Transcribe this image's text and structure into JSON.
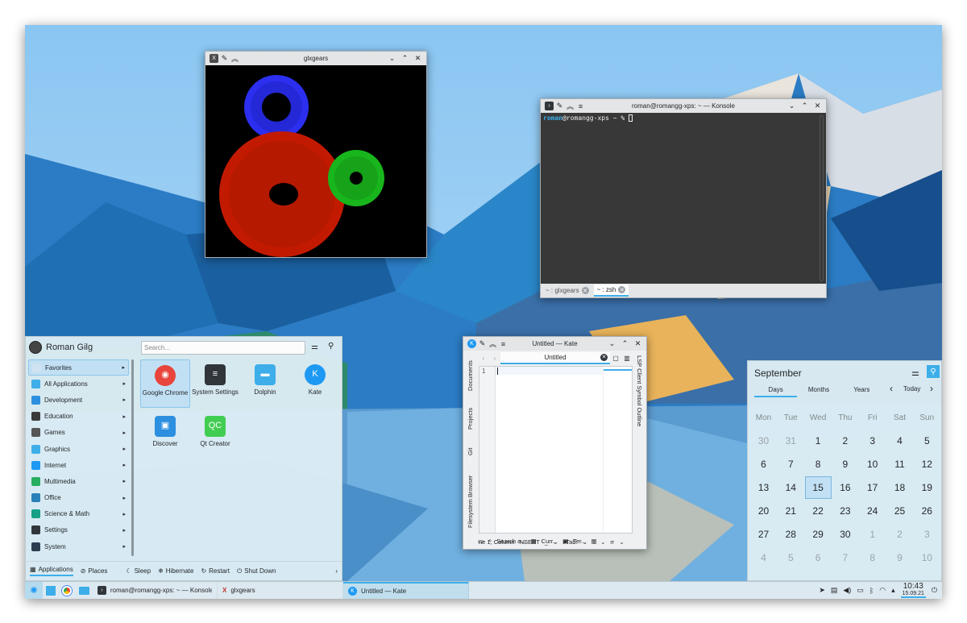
{
  "glxgears": {
    "title": "glxgears"
  },
  "konsole": {
    "title": "roman@romangg-xps: ~ — Konsole",
    "prompt_user": "roman",
    "prompt_rest": "@romangg-xps ~ % ",
    "tabs": [
      "~ : glxgears",
      "~ : zsh"
    ]
  },
  "kate": {
    "title": "Untitled — Kate",
    "tab": "Untitled",
    "line_no": "1",
    "left_panels": [
      "Documents",
      "Projects",
      "Git",
      "Filesystem Browser"
    ],
    "right_panels": [
      "LSP Client Symbol Outline"
    ],
    "status": [
      "ne 1, Column",
      "NSERT",
      "_",
      "t Tab:",
      "1",
      "rr"
    ],
    "bottom_tools": [
      "Search a...",
      "Curr...",
      "Ter..."
    ]
  },
  "launcher": {
    "user": "Roman Gilg",
    "search_placeholder": "Search...",
    "categories": [
      "Favorites",
      "All Applications",
      "Development",
      "Education",
      "Games",
      "Graphics",
      "Internet",
      "Multimedia",
      "Office",
      "Science & Math",
      "Settings",
      "System"
    ],
    "apps": [
      {
        "name": "Google Chrome",
        "icon": "chrome-icon",
        "color": "#e8453c"
      },
      {
        "name": "System Settings",
        "icon": "settings-icon",
        "color": "#31363b"
      },
      {
        "name": "Dolphin",
        "icon": "folder-icon",
        "color": "#3daee9"
      },
      {
        "name": "Kate",
        "icon": "kate-icon",
        "color": "#1d99f3"
      },
      {
        "name": "Discover",
        "icon": "discover-icon",
        "color": "#2d8fe0"
      },
      {
        "name": "Qt Creator",
        "icon": "qt-icon",
        "color": "#41cd52"
      }
    ],
    "footer": {
      "applications": "Applications",
      "places": "Places",
      "sleep": "Sleep",
      "hibernate": "Hibernate",
      "restart": "Restart",
      "shutdown": "Shut Down"
    }
  },
  "calendar": {
    "month": "September",
    "tabs": [
      "Days",
      "Months",
      "Years"
    ],
    "today_label": "Today",
    "weekdays": [
      "Mon",
      "Tue",
      "Wed",
      "Thu",
      "Fri",
      "Sat",
      "Sun"
    ],
    "weeks": [
      [
        "30",
        "31",
        "1",
        "2",
        "3",
        "4",
        "5"
      ],
      [
        "6",
        "7",
        "8",
        "9",
        "10",
        "11",
        "12"
      ],
      [
        "13",
        "14",
        "15",
        "16",
        "17",
        "18",
        "19"
      ],
      [
        "20",
        "21",
        "22",
        "23",
        "24",
        "25",
        "26"
      ],
      [
        "27",
        "28",
        "29",
        "30",
        "1",
        "2",
        "3"
      ],
      [
        "4",
        "5",
        "6",
        "7",
        "8",
        "9",
        "10"
      ]
    ],
    "today": "15"
  },
  "panel": {
    "tasks": [
      "roman@romangg-xps: ~ — Konsole",
      "glxgears",
      "Untitled — Kate"
    ],
    "time": "10:43",
    "date": "15.09.21"
  },
  "colors": {
    "accent": "#3daee9",
    "gear_red": "#c21a00",
    "gear_green": "#19b51c",
    "gear_blue": "#2c2ff0"
  }
}
